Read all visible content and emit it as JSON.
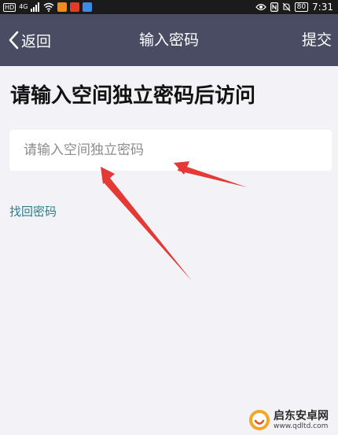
{
  "status_bar": {
    "network_badge": "HD",
    "network_type": "4G",
    "battery": "80",
    "time": "7:31"
  },
  "nav": {
    "back_label": "返回",
    "title": "输入密码",
    "submit_label": "提交"
  },
  "main": {
    "heading": "请输入空间独立密码后访问",
    "password_placeholder": "请输入空间独立密码",
    "recover_link": "找回密码"
  },
  "colors": {
    "nav_background": "#4a4c63",
    "page_background": "#f3f3f7",
    "link": "#2e7d8c",
    "annotation_arrow": "#e53935"
  },
  "watermark": {
    "name": "启东安卓网",
    "url": "www.qdltd.com"
  }
}
